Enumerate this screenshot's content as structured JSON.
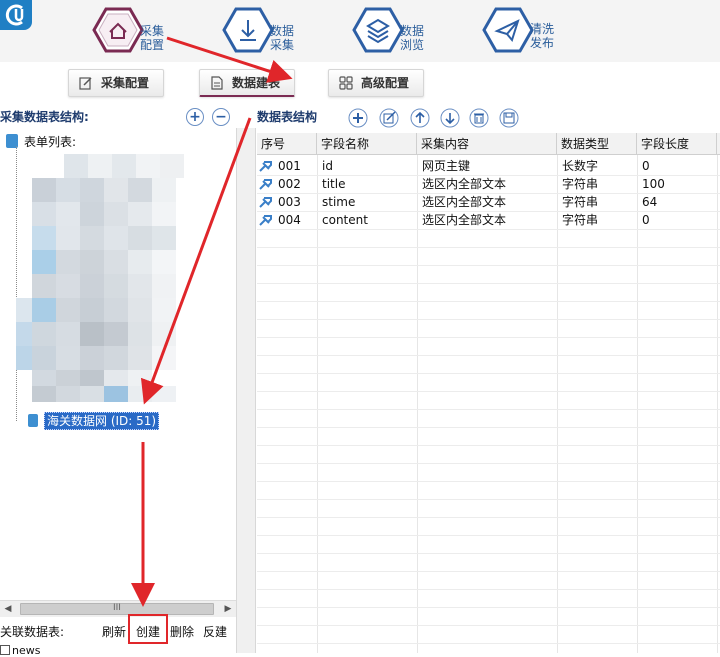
{
  "toolbar": {
    "buttons": [
      {
        "line1": "采集",
        "line2": "配置",
        "icon": "home-icon"
      },
      {
        "line1": "数据",
        "line2": "采集",
        "icon": "download-icon"
      },
      {
        "line1": "数据",
        "line2": "浏览",
        "icon": "layers-icon"
      },
      {
        "line1": "清洗",
        "line2": "发布",
        "icon": "send-icon"
      }
    ]
  },
  "subtabs": [
    {
      "label": "采集配置",
      "icon": "edit-icon"
    },
    {
      "label": "数据建表",
      "icon": "document-icon"
    },
    {
      "label": "高级配置",
      "icon": "grid-icon"
    }
  ],
  "left": {
    "title": "采集数据表结构:",
    "add": "+",
    "remove": "−",
    "tree_root": "表单列表:",
    "selected_item": "海关数据网 (ID: 51)",
    "bottom_title": "关联数据表:",
    "actions": [
      "刷新",
      "创建",
      "删除",
      "反建"
    ],
    "news_item": "news",
    "scroll_grip": "III"
  },
  "right": {
    "title": "数据表结构",
    "columns": [
      "序号",
      "字段名称",
      "采集内容",
      "数据类型",
      "字段长度"
    ],
    "rows": [
      {
        "no": "001",
        "name": "id",
        "content": "网页主键",
        "type": "长数字",
        "length": "0"
      },
      {
        "no": "002",
        "name": "title",
        "content": "选区内全部文本",
        "type": "字符串",
        "length": "100"
      },
      {
        "no": "003",
        "name": "stime",
        "content": "选区内全部文本",
        "type": "字符串",
        "length": "64"
      },
      {
        "no": "004",
        "name": "content",
        "content": "选区内全部文本",
        "type": "字符串",
        "length": "0"
      }
    ]
  },
  "colors": {
    "accent_blue": "#2a6ac6",
    "title_blue": "#1f3c6e",
    "arrow_red": "#e0262a",
    "tab_underline": "#7a2a52"
  }
}
